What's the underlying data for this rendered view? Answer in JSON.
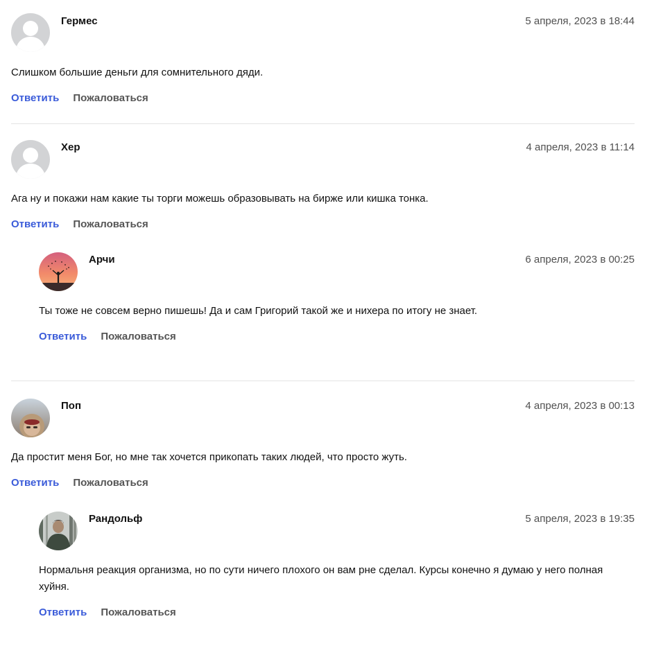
{
  "comments": [
    {
      "author": "Гермес",
      "date": "5 апреля, 2023 в 18:44",
      "text": "Слишком большие деньги для сомнительного дяди.",
      "reply_label": "Ответить",
      "report_label": "Пожаловаться",
      "avatar": "default-user-avatar"
    },
    {
      "author": "Хер",
      "date": "4 апреля, 2023 в 11:14",
      "text": "Ага ну и покажи нам какие ты торги можешь образовывать на бирже или кишка тонка.",
      "reply_label": "Ответить",
      "report_label": "Пожаловаться",
      "avatar": "default-user-avatar",
      "replies": [
        {
          "author": "Арчи",
          "date": "6 апреля, 2023 в 00:25",
          "text": "Ты тоже не совсем верно пишешь! Да и сам Григорий такой же и нихера по итогу не знает.",
          "reply_label": "Ответить",
          "report_label": "Пожаловаться",
          "avatar": "sunset-silhouette-avatar"
        }
      ]
    },
    {
      "author": "Поп",
      "date": "4 апреля, 2023 в 00:13",
      "text": "Да простит меня Бог, но мне так хочется прикопать таких людей, что просто жуть.",
      "reply_label": "Ответить",
      "report_label": "Пожаловаться",
      "avatar": "winter-hood-photo-avatar",
      "replies": [
        {
          "author": "Рандольф",
          "date": "5 апреля, 2023 в 19:35",
          "text": "Нормальня реакция организма, но по сути ничего плохого он вам рне сделал. Курсы конечно я думаю у него полная хуйня.",
          "reply_label": "Ответить",
          "report_label": "Пожаловаться",
          "avatar": "forest-man-photo-avatar"
        }
      ]
    }
  ],
  "colors": {
    "reply_link": "#3a5bd9",
    "report_link": "#555555",
    "date": "#505050",
    "separator": "#e4e4e4"
  }
}
